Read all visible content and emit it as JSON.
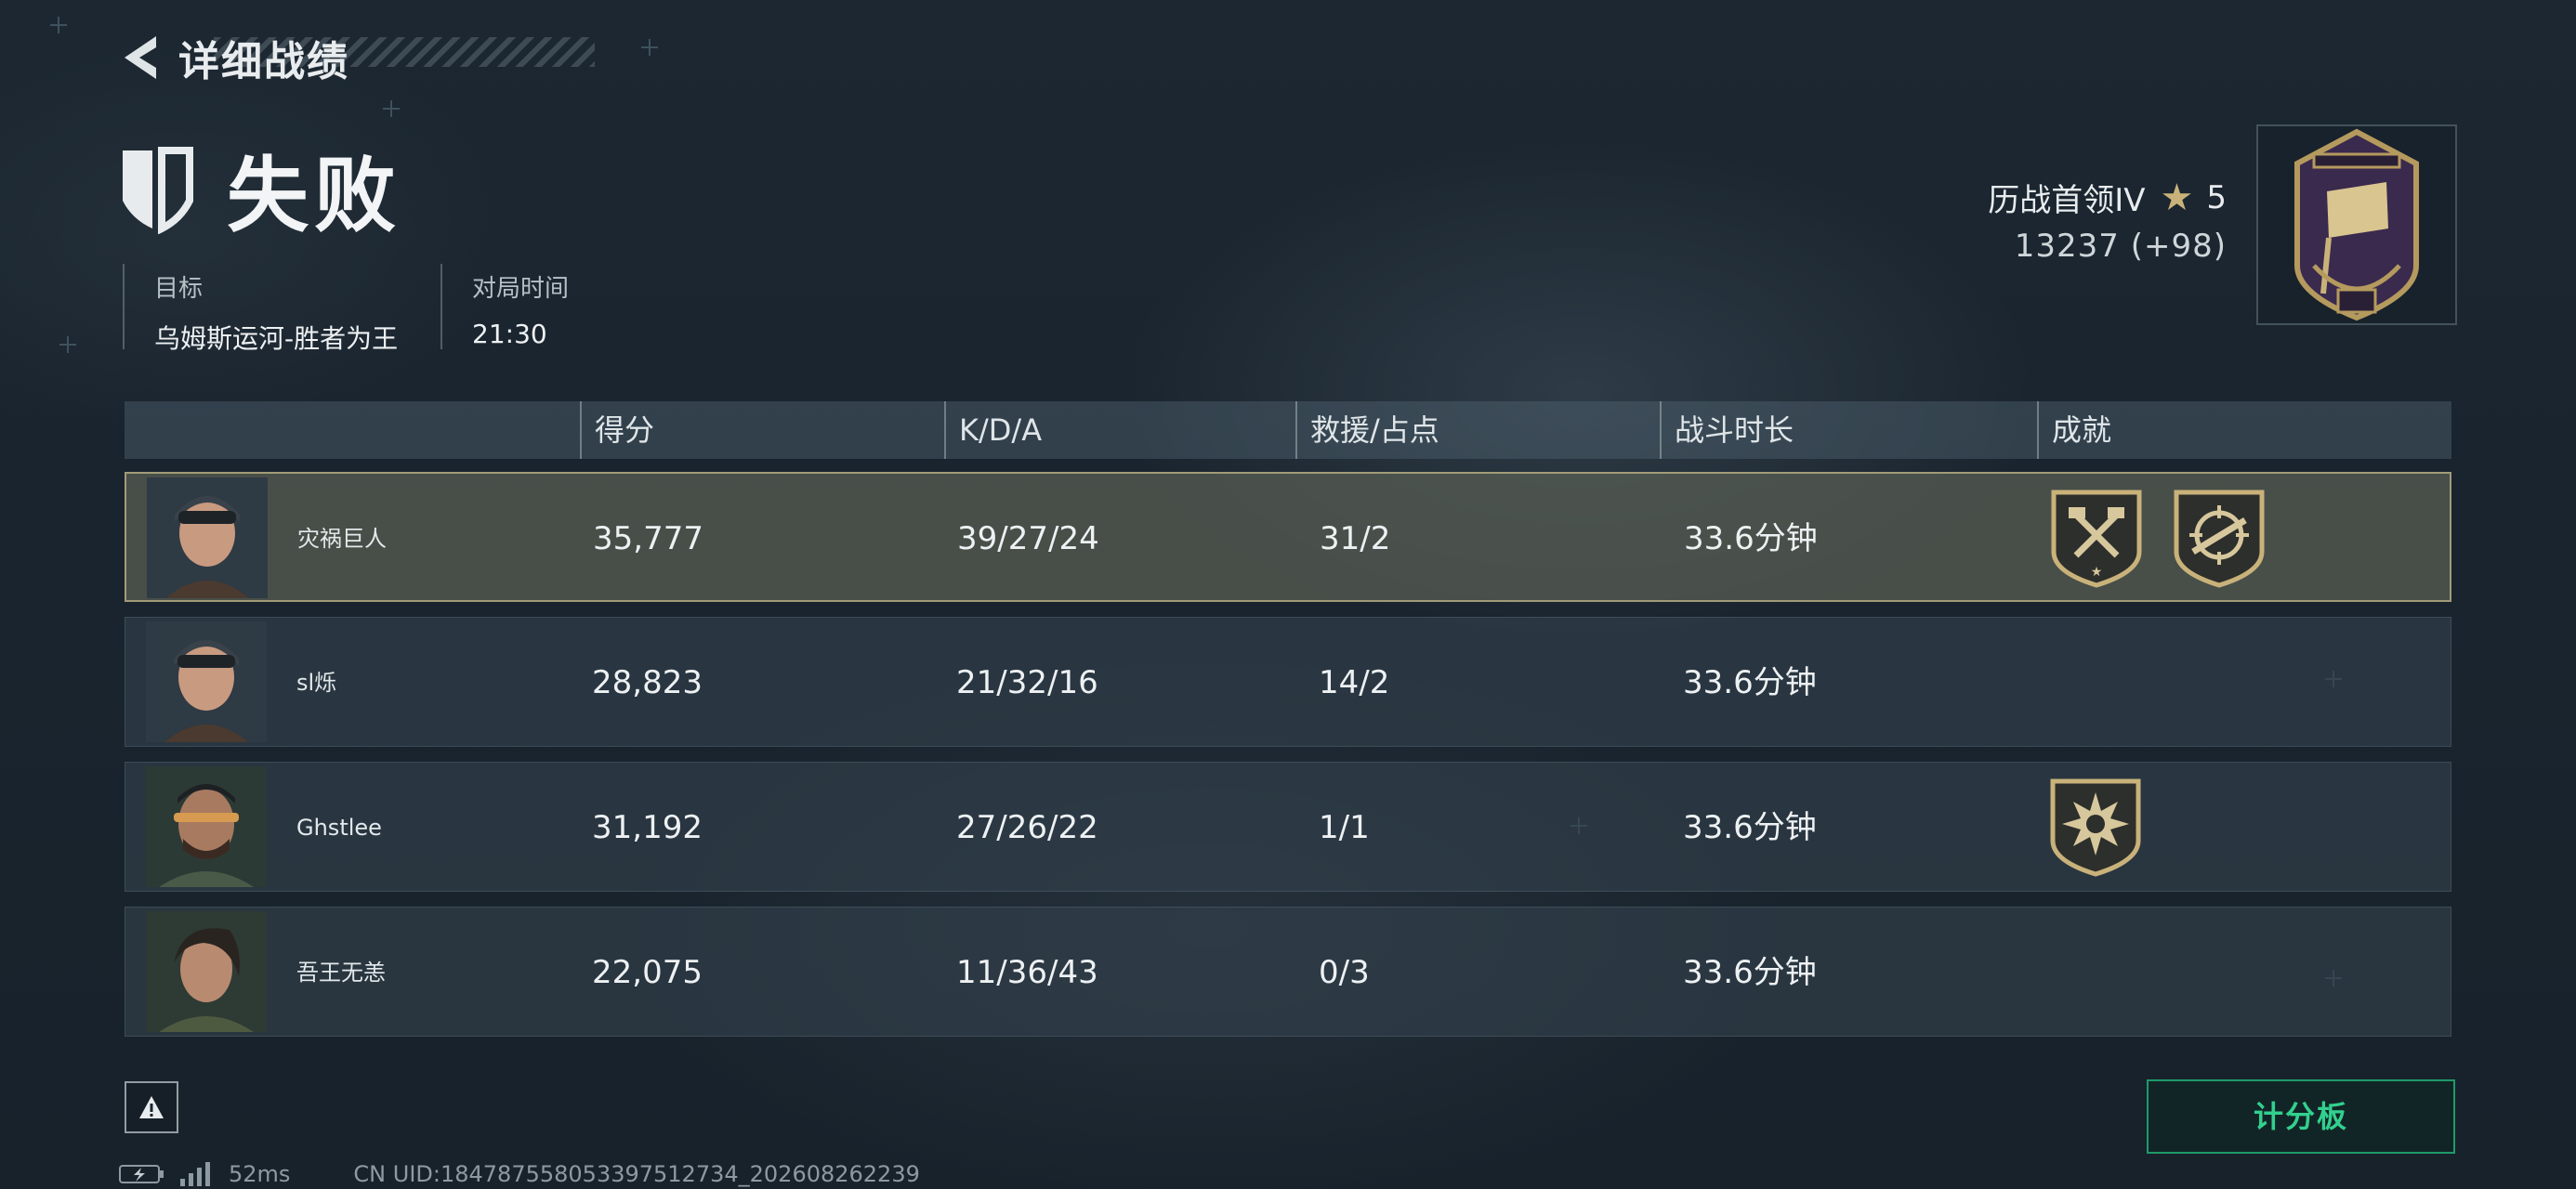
{
  "header": {
    "back_title": "详细战绩",
    "result": "失败"
  },
  "meta": {
    "objective_label": "目标",
    "objective_value": "乌姆斯运河-胜者为王",
    "duration_label": "对局时间",
    "duration_value": "21:30"
  },
  "rank": {
    "title": "历战首领IV",
    "stars": "5",
    "score": "13237 (+98)",
    "badge_icon": "rank-emblem-icon"
  },
  "table": {
    "headers": [
      "得分",
      "K/D/A",
      "救援/占点",
      "战斗时长",
      "成就"
    ],
    "rows": [
      {
        "name": "灾祸巨人",
        "score": "35,777",
        "kda": "39/27/24",
        "rescue": "31/2",
        "time": "33.6分钟",
        "achievements": [
          "axes-badge-icon",
          "crosshair-rifle-badge-icon"
        ]
      },
      {
        "name": "sl烁",
        "score": "28,823",
        "kda": "21/32/16",
        "rescue": "14/2",
        "time": "33.6分钟",
        "achievements": []
      },
      {
        "name": "Ghstlee",
        "score": "31,192",
        "kda": "27/26/22",
        "rescue": "1/1",
        "time": "33.6分钟",
        "achievements": [
          "explosion-badge-icon"
        ]
      },
      {
        "name": "吾王无恙",
        "score": "22,075",
        "kda": "11/36/43",
        "rescue": "0/3",
        "time": "33.6分钟",
        "achievements": []
      }
    ]
  },
  "footer": {
    "scoreboard_label": "计分板",
    "ping": "52ms",
    "uid": "CN UID:1847875580533975127​34_202608262239"
  },
  "colors": {
    "accent_green": "#32d08f",
    "highlight_row_border": "#c8bc8c",
    "badge_gold": "#c9b27a"
  }
}
